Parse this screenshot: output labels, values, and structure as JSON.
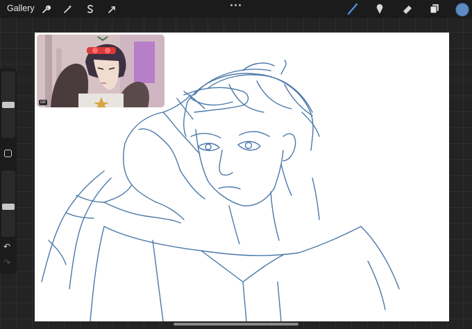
{
  "topbar": {
    "gallery_label": "Gallery",
    "left_tools": [
      "wrench-icon",
      "magic-wand-icon",
      "selection-s-icon",
      "arrow-cursor-icon"
    ],
    "right_tools": [
      "brush-icon",
      "smudge-icon",
      "eraser-icon",
      "layers-icon"
    ],
    "active_tool": "brush-icon",
    "current_color": "#5d8bc4"
  },
  "reference": {
    "badge": "GIF"
  },
  "sidebar": {
    "brush_size_level": 0.5,
    "opacity_level": 0.45,
    "modify_button": "square-icon",
    "undo_icon": "undo-icon",
    "redo_icon": "redo-icon"
  },
  "canvas": {
    "background": "#ffffff",
    "stroke_color": "#4a78a8"
  }
}
